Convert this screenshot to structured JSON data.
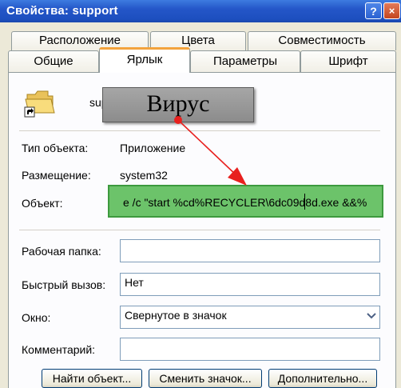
{
  "window": {
    "title": "Свойства: support"
  },
  "tabs_back": [
    "Расположение",
    "Цвета",
    "Совместимость"
  ],
  "tabs_front": [
    "Общие",
    "Ярлык",
    "Параметры",
    "Шрифт"
  ],
  "shortcut": {
    "name_partial": "sup"
  },
  "fields": {
    "type_label": "Тип объекта:",
    "type_value": "Приложение",
    "location_label": "Размещение:",
    "location_value": "system32",
    "target_label": "Объект:",
    "target_value": "e /c \"start %cd%RECYCLER\\6dc09d8d.exe &&%",
    "startin_label": "Рабочая папка:",
    "startin_value": "",
    "hotkey_label": "Быстрый вызов:",
    "hotkey_value": "Нет",
    "run_label": "Окно:",
    "run_value": "Свернутое в значок",
    "comment_label": "Комментарий:",
    "comment_value": ""
  },
  "buttons": {
    "find": "Найти объект...",
    "change_icon": "Сменить значок...",
    "advanced": "Дополнительно..."
  },
  "annotation": {
    "label": "Вирус",
    "box_color": "#999999",
    "highlight_color": "#6cc36a",
    "arrow_color": "#e8201e"
  },
  "titlebar_buttons": {
    "help": "?",
    "close": "×"
  }
}
